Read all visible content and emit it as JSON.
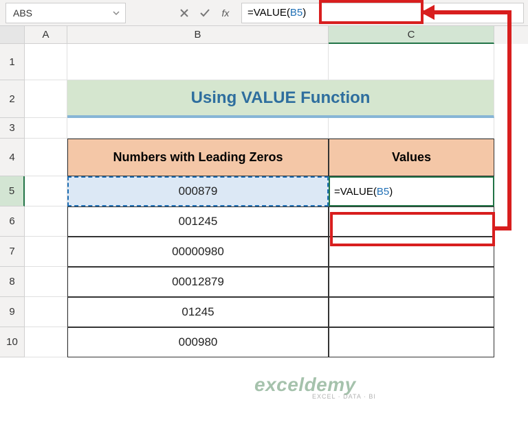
{
  "name_box": "ABS",
  "formula_bar": {
    "prefix": "=VALUE(",
    "ref": "B5",
    "suffix": ")"
  },
  "columns": [
    "A",
    "B",
    "C"
  ],
  "rows": [
    "1",
    "2",
    "3",
    "4",
    "5",
    "6",
    "7",
    "8",
    "9",
    "10"
  ],
  "title": "Using VALUE Function",
  "headers": {
    "b": "Numbers with Leading Zeros",
    "c": "Values"
  },
  "data_b": [
    "000879",
    "001245",
    "00000980",
    "00012879",
    "01245",
    "000980"
  ],
  "c5": {
    "prefix": "=VALUE(",
    "ref": "B5",
    "suffix": ")"
  },
  "watermark": {
    "line1": "exceldemy",
    "line2": "EXCEL · DATA · BI"
  }
}
